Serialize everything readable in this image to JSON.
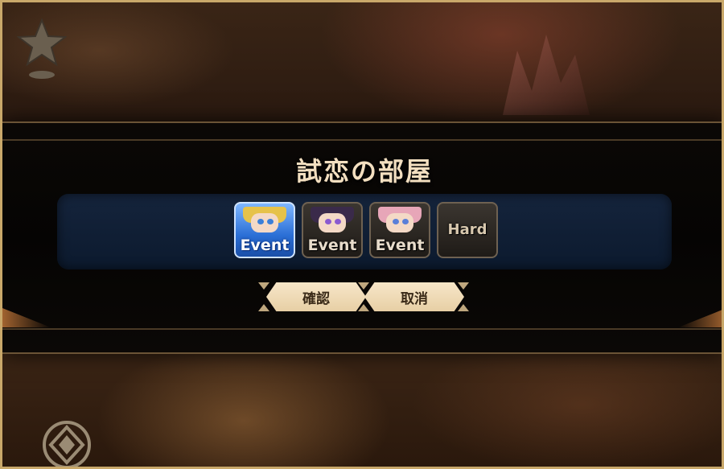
{
  "dialog": {
    "title": "試恋の部屋",
    "difficulty_options": [
      {
        "label": "Event",
        "selected": true,
        "hair_color": "#e6c24a",
        "eye_color": "#3a7fd9"
      },
      {
        "label": "Event",
        "selected": false,
        "hair_color": "#3a2a4a",
        "eye_color": "#8a5ad0"
      },
      {
        "label": "Event",
        "selected": false,
        "hair_color": "#e7a6b8",
        "eye_color": "#5a7fd9"
      },
      {
        "label": "Hard",
        "selected": false
      }
    ],
    "confirm_label": "確認",
    "cancel_label": "取消"
  },
  "hud": {
    "star_icon": "star-icon",
    "emblem_icon": "diamond-emblem-icon"
  }
}
